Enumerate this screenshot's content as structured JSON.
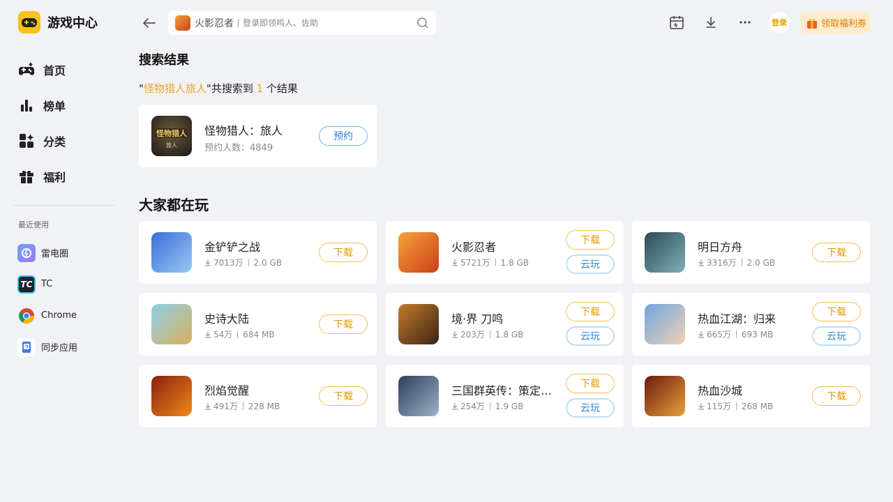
{
  "app": {
    "title": "游戏中心"
  },
  "nav": [
    {
      "label": "首页",
      "icon": "gamepad-icon"
    },
    {
      "label": "榜单",
      "icon": "ranking-icon"
    },
    {
      "label": "分类",
      "icon": "category-icon"
    },
    {
      "label": "福利",
      "icon": "gift-icon"
    }
  ],
  "recent": {
    "title": "最近使用",
    "items": [
      {
        "label": "雷电圈",
        "icon": "leidian-icon",
        "color": "#7b8ef0"
      },
      {
        "label": "TC",
        "icon": "tc-icon",
        "color": "#1d2330"
      },
      {
        "label": "Chrome",
        "icon": "chrome-icon",
        "color": "#ffffff"
      },
      {
        "label": "同步应用",
        "icon": "sync-app-icon",
        "color": "#ffffff"
      }
    ]
  },
  "search": {
    "value": "火影忍者",
    "placeholder": "登录即领鸣人、佐助"
  },
  "header": {
    "login_label": "登录",
    "coupon_label": "领取福利券"
  },
  "results": {
    "heading": "搜索结果",
    "line": {
      "prefix": "\"",
      "keyword": "怪物猎人旅人",
      "middle": "\"共搜索到 ",
      "count": "1",
      "suffix": " 个结果"
    },
    "item": {
      "name": "怪物猎人：旅人",
      "meta": "预约人数：4849",
      "button": "预约"
    }
  },
  "popular": {
    "heading": "大家都在玩",
    "download_label": "下载",
    "cloud_label": "云玩",
    "games": [
      {
        "name": "金铲铲之战",
        "downloads": "7013万",
        "size": "2.0 GB",
        "cloud": false
      },
      {
        "name": "火影忍者",
        "downloads": "5721万",
        "size": "1.8 GB",
        "cloud": true
      },
      {
        "name": "明日方舟",
        "downloads": "3316万",
        "size": "2.0 GB",
        "cloud": false
      },
      {
        "name": "史诗大陆",
        "downloads": "54万",
        "size": "684 MB",
        "cloud": false
      },
      {
        "name": "境·界 刀鸣",
        "downloads": "203万",
        "size": "1.8 GB",
        "cloud": true
      },
      {
        "name": "热血江湖：归来",
        "downloads": "665万",
        "size": "693 MB",
        "cloud": true
      },
      {
        "name": "烈焰觉醒",
        "downloads": "491万",
        "size": "228 MB",
        "cloud": false
      },
      {
        "name": "三国群英传：策定…",
        "downloads": "254万",
        "size": "1.9 GB",
        "cloud": true
      },
      {
        "name": "热血沙城",
        "downloads": "115万",
        "size": "268 MB",
        "cloud": false
      }
    ]
  }
}
